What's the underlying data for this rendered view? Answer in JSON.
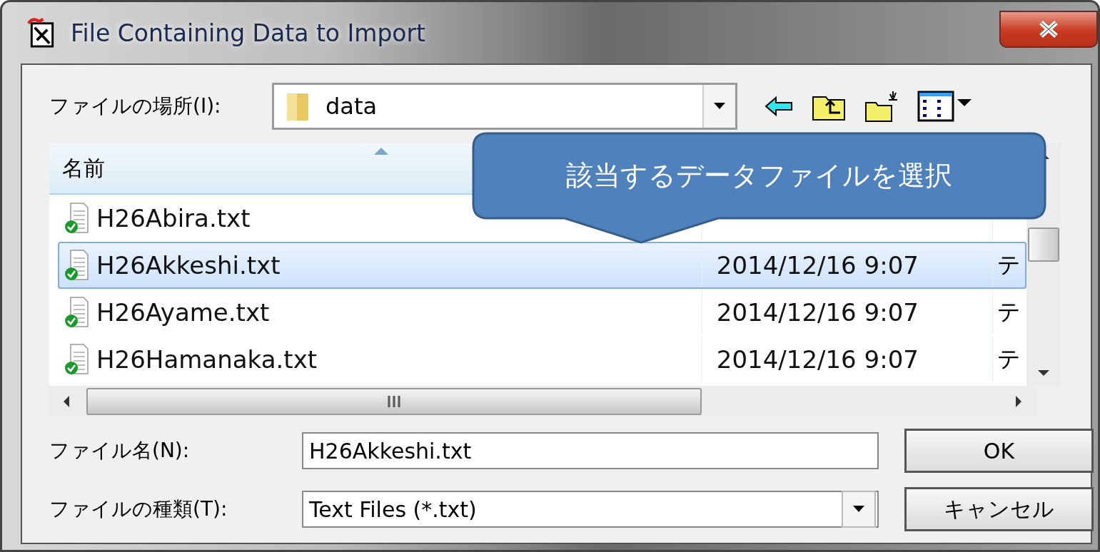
{
  "window": {
    "title": "File Containing Data to Import"
  },
  "location": {
    "label": "ファイルの場所(I):",
    "value": "data"
  },
  "list": {
    "columns": [
      {
        "label": "名前"
      }
    ],
    "rows": [
      {
        "name": "H26Abira.txt",
        "selected": false
      },
      {
        "name": "H26Akkeshi.txt",
        "date": "2014/12/16 9:07",
        "type": "テ",
        "selected": true
      },
      {
        "name": "H26Ayame.txt",
        "date": "2014/12/16 9:07",
        "type": "テ",
        "selected": false
      },
      {
        "name": "H26Hamanaka.txt",
        "date": "2014/12/16 9:07",
        "type": "テ",
        "selected": false
      }
    ]
  },
  "file_name": {
    "label": "ファイル名(N):",
    "value": "H26Akkeshi.txt"
  },
  "file_type": {
    "label": "ファイルの種類(T):",
    "value": "Text Files (*.txt)"
  },
  "buttons": [
    {
      "label": "OK"
    },
    {
      "label": "キャンセル"
    }
  ],
  "callout": {
    "text": "該当するデータファイルを選択"
  }
}
